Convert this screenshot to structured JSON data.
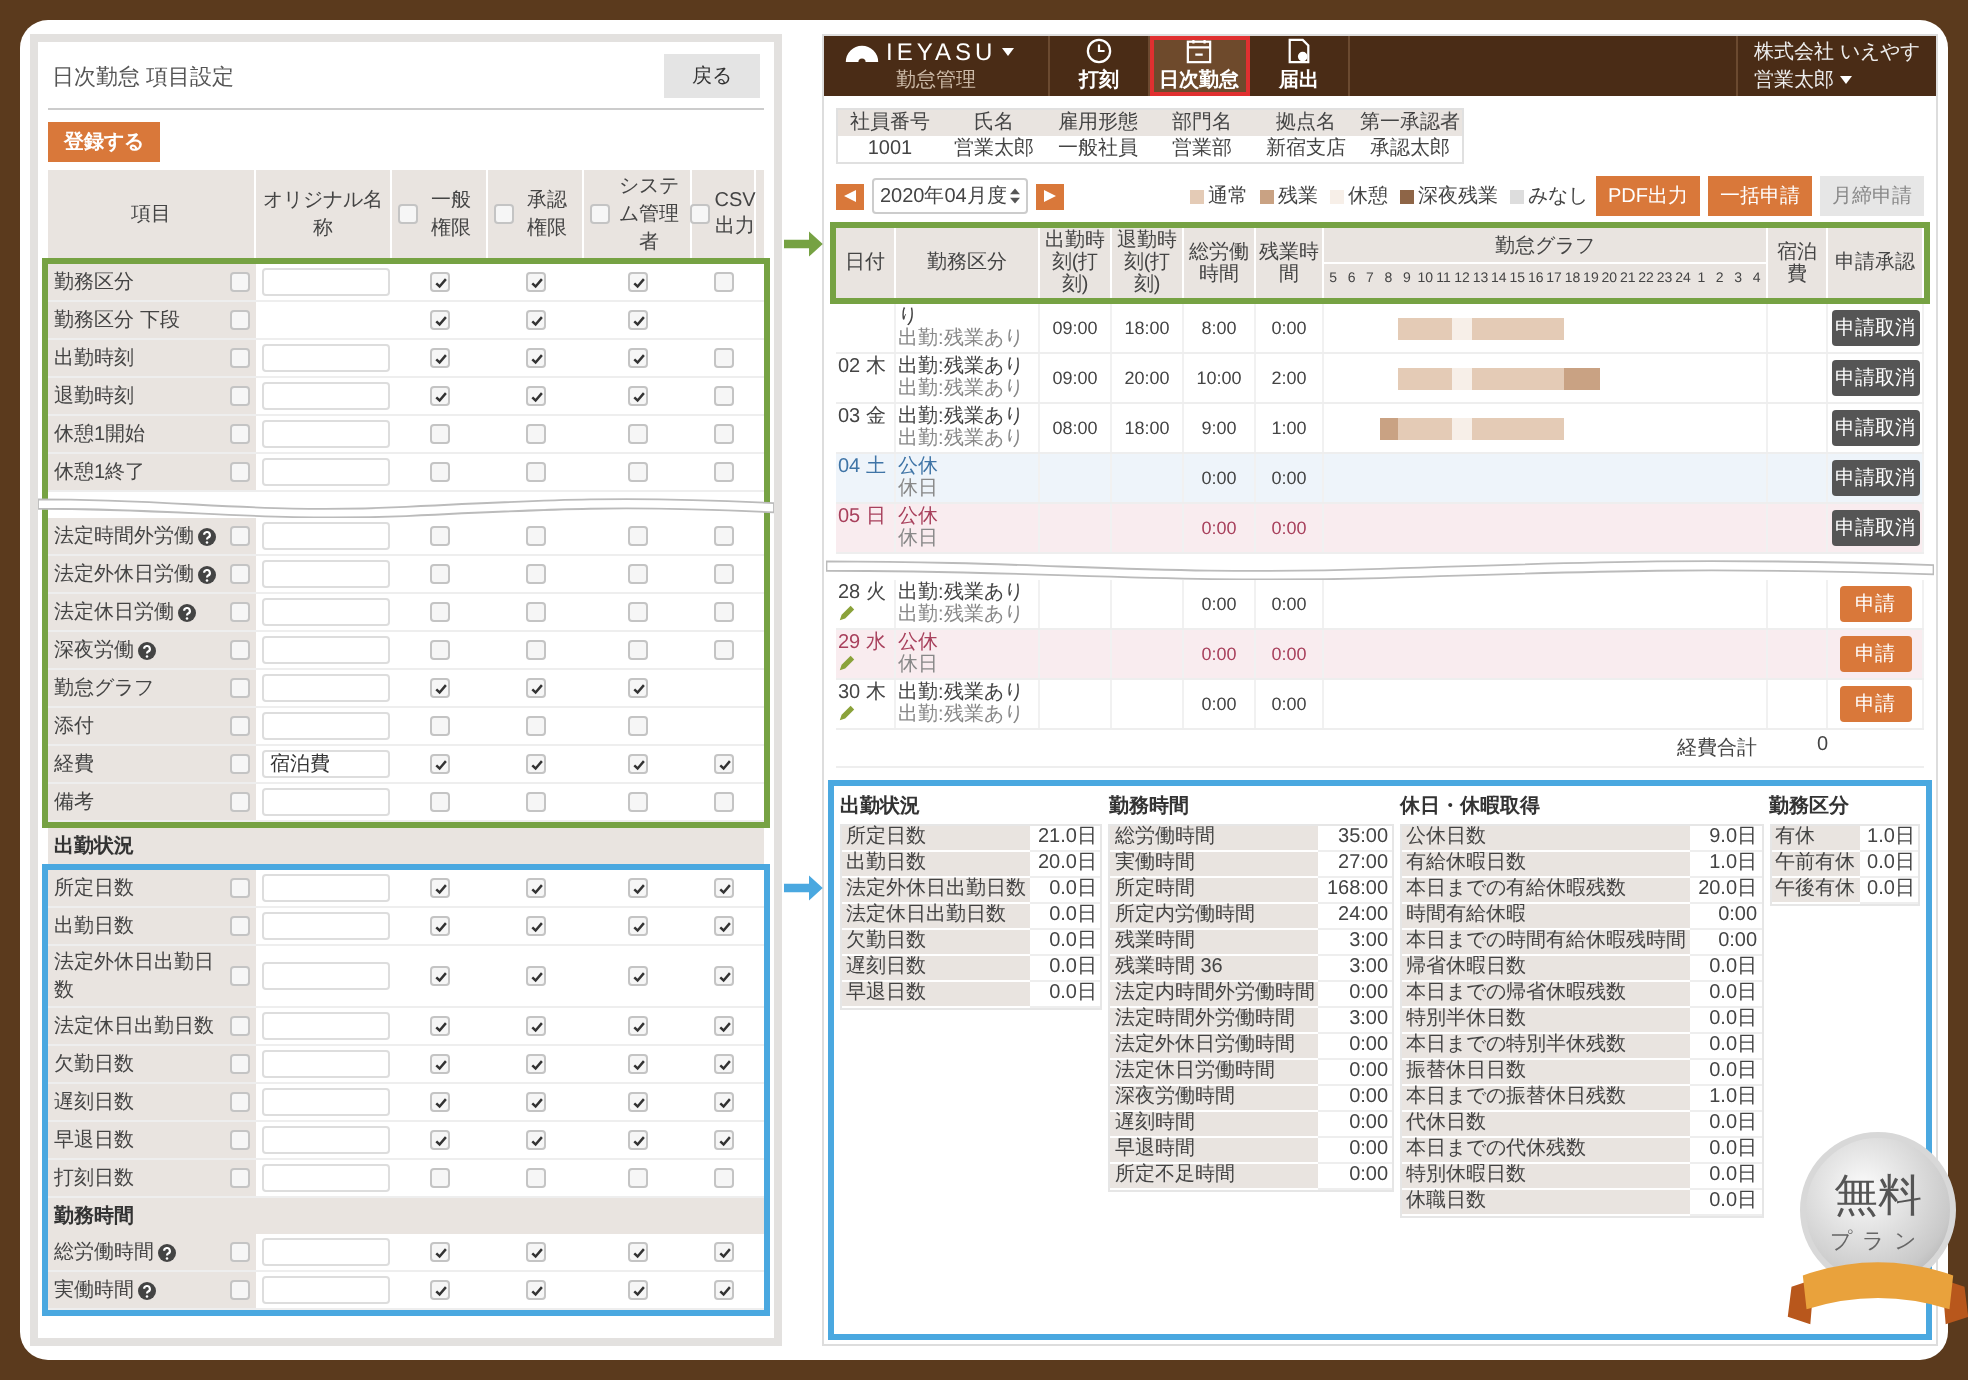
{
  "left": {
    "title": "日次勤怠 項目設定",
    "back_button": "戻る",
    "register_button": "登録する",
    "columns": [
      {
        "label": "項目"
      },
      {
        "label": "オリジナル名称"
      },
      {
        "label": "一般権限",
        "checked": false
      },
      {
        "label": "承認権限",
        "checked": false
      },
      {
        "label": "システム管理者",
        "checked": false
      },
      {
        "label": "CSV出力",
        "checked": false
      }
    ],
    "blocks": [
      {
        "kind": "frame",
        "color": "#76a243",
        "rows": [
          {
            "kind": "item",
            "label": "勤務区分",
            "help": false,
            "checked": false,
            "input": true,
            "perms": [
              true,
              true,
              true,
              false
            ]
          },
          {
            "kind": "item",
            "label": "勤務区分 下段",
            "help": false,
            "checked": false,
            "input": false,
            "perms": [
              true,
              true,
              true
            ]
          },
          {
            "kind": "item",
            "label": "出勤時刻",
            "help": false,
            "checked": false,
            "input": true,
            "perms": [
              true,
              true,
              true,
              false
            ]
          },
          {
            "kind": "item",
            "label": "退勤時刻",
            "help": false,
            "checked": false,
            "input": true,
            "perms": [
              true,
              true,
              true,
              false
            ]
          },
          {
            "kind": "item",
            "label": "休憩1開始",
            "help": false,
            "checked": false,
            "input": true,
            "perms": [
              false,
              false,
              false,
              false
            ]
          },
          {
            "kind": "item",
            "label": "休憩1終了",
            "help": false,
            "checked": false,
            "input": true,
            "perms": [
              false,
              false,
              false,
              false
            ]
          },
          {
            "kind": "break"
          },
          {
            "kind": "item",
            "label": "法定時間外労働",
            "help": true,
            "checked": false,
            "input": true,
            "perms": [
              false,
              false,
              false,
              false
            ]
          },
          {
            "kind": "item",
            "label": "法定外休日労働",
            "help": true,
            "checked": false,
            "input": true,
            "perms": [
              false,
              false,
              false,
              false
            ]
          },
          {
            "kind": "item",
            "label": "法定休日労働",
            "help": true,
            "checked": false,
            "input": true,
            "perms": [
              false,
              false,
              false,
              false
            ]
          },
          {
            "kind": "item",
            "label": "深夜労働",
            "help": true,
            "checked": false,
            "input": true,
            "perms": [
              false,
              false,
              false,
              false
            ]
          },
          {
            "kind": "item",
            "label": "勤怠グラフ",
            "help": false,
            "checked": false,
            "input": true,
            "perms": [
              true,
              true,
              true
            ]
          },
          {
            "kind": "item",
            "label": "添付",
            "help": false,
            "checked": false,
            "input": true,
            "perms": [
              false,
              false,
              false
            ]
          },
          {
            "kind": "item",
            "label": "経費",
            "help": false,
            "checked": false,
            "input": true,
            "value": "宿泊費",
            "perms": [
              true,
              true,
              true,
              true
            ]
          },
          {
            "kind": "item",
            "label": "備考",
            "help": false,
            "checked": false,
            "input": true,
            "perms": [
              false,
              false,
              false,
              false
            ]
          }
        ]
      },
      {
        "kind": "section",
        "label": "出勤状況"
      },
      {
        "kind": "frame",
        "color": "#4aa8e0",
        "rows": [
          {
            "kind": "item",
            "label": "所定日数",
            "help": false,
            "checked": false,
            "input": true,
            "perms": [
              true,
              true,
              true,
              true
            ]
          },
          {
            "kind": "item",
            "label": "出勤日数",
            "help": false,
            "checked": false,
            "input": true,
            "perms": [
              true,
              true,
              true,
              true
            ]
          },
          {
            "kind": "item",
            "label": "法定外休日出勤日数",
            "help": false,
            "checked": false,
            "input": true,
            "perms": [
              true,
              true,
              true,
              true
            ]
          },
          {
            "kind": "item",
            "label": "法定休日出勤日数",
            "help": false,
            "checked": false,
            "input": true,
            "perms": [
              true,
              true,
              true,
              true
            ]
          },
          {
            "kind": "item",
            "label": "欠勤日数",
            "help": false,
            "checked": false,
            "input": true,
            "perms": [
              true,
              true,
              true,
              true
            ]
          },
          {
            "kind": "item",
            "label": "遅刻日数",
            "help": false,
            "checked": false,
            "input": true,
            "perms": [
              true,
              true,
              true,
              true
            ]
          },
          {
            "kind": "item",
            "label": "早退日数",
            "help": false,
            "checked": false,
            "input": true,
            "perms": [
              true,
              true,
              true,
              true
            ]
          },
          {
            "kind": "item",
            "label": "打刻日数",
            "help": false,
            "checked": false,
            "input": true,
            "perms": [
              false,
              false,
              false,
              false
            ]
          },
          {
            "kind": "section",
            "label": "勤務時間"
          },
          {
            "kind": "item",
            "label": "総労働時間",
            "help": true,
            "checked": false,
            "input": true,
            "perms": [
              true,
              true,
              true,
              true
            ]
          },
          {
            "kind": "item",
            "label": "実働時間",
            "help": true,
            "checked": false,
            "input": true,
            "perms": [
              true,
              true,
              true,
              true
            ]
          }
        ]
      }
    ]
  },
  "right": {
    "brand": {
      "name": "IEYASU",
      "subtitle": "勤怠管理"
    },
    "nav": [
      {
        "label": "打刻",
        "kind": "clock",
        "selected": false
      },
      {
        "label": "日次勤怠",
        "kind": "calendar",
        "selected": true
      },
      {
        "label": "届出",
        "kind": "document",
        "selected": false
      }
    ],
    "user": {
      "company": "株式会社 いえやす",
      "name": "営業太郎"
    },
    "employee": {
      "headers": [
        "社員番号",
        "氏名",
        "雇用形態",
        "部門名",
        "拠点名",
        "第一承認者"
      ],
      "values": [
        "1001",
        "営業太郎",
        "一般社員",
        "営業部",
        "新宿支店",
        "承認太郎"
      ]
    },
    "month": "2020年04月度",
    "legend": [
      {
        "label": "通常",
        "color": "#e4cbb6"
      },
      {
        "label": "残業",
        "color": "#c9a283"
      },
      {
        "label": "休憩",
        "color": "#f7efe8"
      },
      {
        "label": "深夜残業",
        "color": "#8e6547"
      },
      {
        "label": "みなし",
        "color": "#dddddd"
      }
    ],
    "actions": [
      {
        "label": "PDF出力",
        "disabled": false
      },
      {
        "label": "一括申請",
        "disabled": false
      },
      {
        "label": "月締申請",
        "disabled": true
      }
    ],
    "table": {
      "color": "#76a243",
      "columns": [
        "日付",
        "勤務区分",
        "出勤時刻(打刻)",
        "退勤時刻(打刻)",
        "総労働時間",
        "残業時間",
        "勤怠グラフ",
        "宿泊費",
        "申請承認"
      ],
      "hours": [
        "5",
        "6",
        "7",
        "8",
        "9",
        "10",
        "11",
        "12",
        "13",
        "14",
        "15",
        "16",
        "17",
        "18",
        "19",
        "20",
        "21",
        "22",
        "23",
        "24",
        "1",
        "2",
        "3",
        "4"
      ],
      "rows": [
        {
          "kind": "weekday",
          "edit": false,
          "status": "り",
          "sub_status": "出勤:残業あり",
          "in": "09:00",
          "out": "18:00",
          "total": "8:00",
          "overtime": "0:00",
          "slots": [
            {
              "kind": "none"
            },
            {
              "kind": "none"
            },
            {
              "kind": "none"
            },
            {
              "kind": "none"
            },
            {
              "kind": "normal"
            },
            {
              "kind": "normal"
            },
            {
              "kind": "normal"
            },
            {
              "kind": "break"
            },
            {
              "kind": "normal"
            },
            {
              "kind": "normal"
            },
            {
              "kind": "normal"
            },
            {
              "kind": "normal"
            },
            {
              "kind": "normal"
            },
            {
              "kind": "none"
            },
            {
              "kind": "none"
            },
            {
              "kind": "none"
            },
            {
              "kind": "none"
            },
            {
              "kind": "none"
            },
            {
              "kind": "none"
            },
            {
              "kind": "none"
            },
            {
              "kind": "none"
            },
            {
              "kind": "none"
            },
            {
              "kind": "none"
            },
            {
              "kind": "none"
            }
          ],
          "action": {
            "label": "申請取消",
            "kind": "cancel"
          }
        },
        {
          "kind": "weekday",
          "date": "02 木",
          "edit": false,
          "status": "出勤:残業あり",
          "sub_status": "出勤:残業あり",
          "in": "09:00",
          "out": "20:00",
          "total": "10:00",
          "overtime": "2:00",
          "slots": [
            {
              "kind": "none"
            },
            {
              "kind": "none"
            },
            {
              "kind": "none"
            },
            {
              "kind": "none"
            },
            {
              "kind": "normal"
            },
            {
              "kind": "normal"
            },
            {
              "kind": "normal"
            },
            {
              "kind": "break"
            },
            {
              "kind": "normal"
            },
            {
              "kind": "normal"
            },
            {
              "kind": "normal"
            },
            {
              "kind": "normal"
            },
            {
              "kind": "normal"
            },
            {
              "kind": "overtime"
            },
            {
              "kind": "overtime"
            },
            {
              "kind": "none"
            },
            {
              "kind": "none"
            },
            {
              "kind": "none"
            },
            {
              "kind": "none"
            },
            {
              "kind": "none"
            },
            {
              "kind": "none"
            },
            {
              "kind": "none"
            },
            {
              "kind": "none"
            },
            {
              "kind": "none"
            }
          ],
          "action": {
            "label": "申請取消",
            "kind": "cancel"
          }
        },
        {
          "kind": "weekday",
          "date": "03 金",
          "edit": false,
          "status": "出勤:残業あり",
          "sub_status": "出勤:残業あり",
          "in": "08:00",
          "out": "18:00",
          "total": "9:00",
          "overtime": "1:00",
          "slots": [
            {
              "kind": "none"
            },
            {
              "kind": "none"
            },
            {
              "kind": "none"
            },
            {
              "kind": "overtime"
            },
            {
              "kind": "normal"
            },
            {
              "kind": "normal"
            },
            {
              "kind": "normal"
            },
            {
              "kind": "break"
            },
            {
              "kind": "normal"
            },
            {
              "kind": "normal"
            },
            {
              "kind": "normal"
            },
            {
              "kind": "normal"
            },
            {
              "kind": "normal"
            },
            {
              "kind": "none"
            },
            {
              "kind": "none"
            },
            {
              "kind": "none"
            },
            {
              "kind": "none"
            },
            {
              "kind": "none"
            },
            {
              "kind": "none"
            },
            {
              "kind": "none"
            },
            {
              "kind": "none"
            },
            {
              "kind": "none"
            },
            {
              "kind": "none"
            },
            {
              "kind": "none"
            }
          ],
          "action": {
            "label": "申請取消",
            "kind": "cancel"
          }
        },
        {
          "kind": "saturday",
          "date": "04 土",
          "edit": false,
          "status": "公休",
          "sub_status": "休日",
          "total": "0:00",
          "overtime": "0:00",
          "action": {
            "label": "申請取消",
            "kind": "cancel"
          }
        },
        {
          "kind": "holiday",
          "date": "05 日",
          "edit": false,
          "status": "公休",
          "sub_status": "休日",
          "total": "0:00",
          "overtime": "0:00",
          "action": {
            "label": "申請取消",
            "kind": "cancel"
          }
        },
        {
          "kind": "break"
        },
        {
          "kind": "weekday",
          "date": "28 火",
          "edit": true,
          "status": "出勤:残業あり",
          "sub_status": "出勤:残業あり",
          "total": "0:00",
          "overtime": "0:00",
          "action": {
            "label": "申請",
            "kind": "apply"
          }
        },
        {
          "kind": "holiday",
          "date": "29 水",
          "edit": true,
          "status": "公休",
          "sub_status": "休日",
          "total": "0:00",
          "overtime": "0:00",
          "action": {
            "label": "申請",
            "kind": "apply"
          }
        },
        {
          "kind": "weekday",
          "date": "30 木",
          "edit": true,
          "status": "出勤:残業あり",
          "sub_status": "出勤:残業あり",
          "total": "0:00",
          "overtime": "0:00",
          "action": {
            "label": "申請",
            "kind": "apply"
          }
        }
      ],
      "total_label": "経費合計",
      "total_value": "0"
    },
    "summary": {
      "color": "#4aa8e0",
      "groups": [
        {
          "title": "出勤状況",
          "items": [
            {
              "label": "所定日数",
              "value": "21.0日"
            },
            {
              "label": "出勤日数",
              "value": "20.0日"
            },
            {
              "label": "法定外休日出勤日数",
              "value": "0.0日"
            },
            {
              "label": "法定休日出勤日数",
              "value": "0.0日"
            },
            {
              "label": "欠勤日数",
              "value": "0.0日"
            },
            {
              "label": "遅刻日数",
              "value": "0.0日"
            },
            {
              "label": "早退日数",
              "value": "0.0日"
            }
          ]
        },
        {
          "title": "勤務時間",
          "items": [
            {
              "label": "総労働時間",
              "value": "35:00"
            },
            {
              "label": "実働時間",
              "value": "27:00"
            },
            {
              "label": "所定時間",
              "value": "168:00"
            },
            {
              "label": "所定内労働時間",
              "value": "24:00"
            },
            {
              "label": "残業時間",
              "value": "3:00"
            },
            {
              "label": "残業時間 36",
              "value": "3:00"
            },
            {
              "label": "法定内時間外労働時間",
              "value": "0:00"
            },
            {
              "label": "法定時間外労働時間",
              "value": "3:00"
            },
            {
              "label": "法定外休日労働時間",
              "value": "0:00"
            },
            {
              "label": "法定休日労働時間",
              "value": "0:00"
            },
            {
              "label": "深夜労働時間",
              "value": "0:00"
            },
            {
              "label": "遅刻時間",
              "value": "0:00"
            },
            {
              "label": "早退時間",
              "value": "0:00"
            },
            {
              "label": "所定不足時間",
              "value": "0:00"
            }
          ]
        },
        {
          "title": "休日・休暇取得",
          "items": [
            {
              "label": "公休日数",
              "value": "9.0日"
            },
            {
              "label": "有給休暇日数",
              "value": "1.0日"
            },
            {
              "label": "本日までの有給休暇残数",
              "value": "20.0日"
            },
            {
              "label": "時間有給休暇",
              "value": "0:00"
            },
            {
              "label": "本日までの時間有給休暇残時間",
              "value": "0:00"
            },
            {
              "label": "帰省休暇日数",
              "value": "0.0日"
            },
            {
              "label": "本日までの帰省休暇残数",
              "value": "0.0日"
            },
            {
              "label": "特別半休日数",
              "value": "0.0日"
            },
            {
              "label": "本日までの特別半休残数",
              "value": "0.0日"
            },
            {
              "label": "振替休日日数",
              "value": "0.0日"
            },
            {
              "label": "本日までの振替休日残数",
              "value": "1.0日"
            },
            {
              "label": "代休日数",
              "value": "0.0日"
            },
            {
              "label": "本日までの代休残数",
              "value": "0.0日"
            },
            {
              "label": "特別休暇日数",
              "value": "0.0日"
            },
            {
              "label": "休職日数",
              "value": "0.0日"
            }
          ]
        },
        {
          "title": "勤務区分",
          "items": [
            {
              "label": "有休",
              "value": "1.0日"
            },
            {
              "label": "午前有休",
              "value": "0.0日"
            },
            {
              "label": "午後有休",
              "value": "0.0日"
            }
          ]
        }
      ]
    }
  },
  "badge": {
    "title": "無料",
    "subtitle": "プラン"
  }
}
